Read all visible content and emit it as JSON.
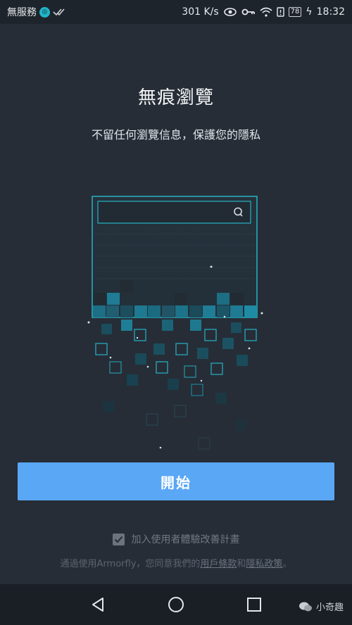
{
  "status_bar": {
    "carrier": "無服務",
    "speed": "301 K/s",
    "battery": "78",
    "time": "18:32"
  },
  "main": {
    "title": "無痕瀏覽",
    "subtitle": "不留任何瀏覽信息，保護您的隱私",
    "start_button": "開始",
    "consent_label": "加入使用者體驗改善計畫",
    "consent_checked": true,
    "terms_prefix": "通過使用Armorfly，您同意我們的",
    "terms_link1": "用戶條款",
    "terms_and": "和",
    "terms_link2": "隱私政策",
    "terms_suffix": "。"
  },
  "watermark": "小奇趣",
  "colors": {
    "background": "#262d36",
    "accent_button": "#5aa7f5",
    "teal": "#1fb5c7"
  }
}
